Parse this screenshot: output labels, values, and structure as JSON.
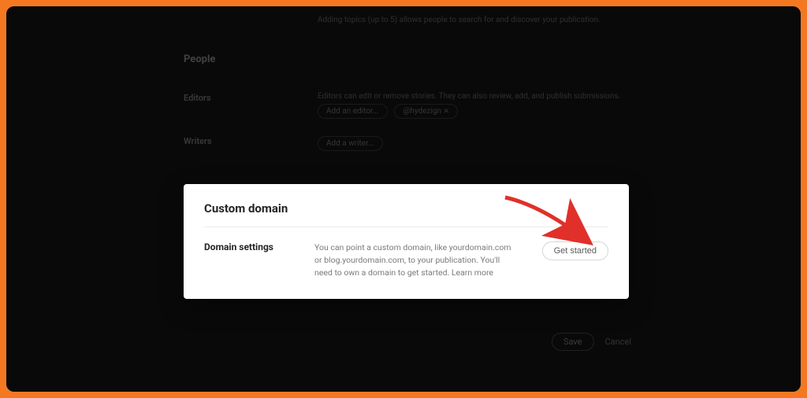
{
  "bg": {
    "top_note": "Adding topics (up to 5) allows people to search for and discover your publication.",
    "people_heading": "People",
    "editors_label": "Editors",
    "editors_desc": "Editors can edit or remove stories. They can also review, add, and publish submissions.",
    "add_editor": "Add an editor...",
    "editor_chip": "@hydezign",
    "writers_label": "Writers",
    "add_writer": "Add a writer...",
    "save": "Save",
    "cancel": "Cancel"
  },
  "modal": {
    "title": "Custom domain",
    "row_label": "Domain settings",
    "description": "You can point a custom domain, like yourdomain.com or blog.yourdomain.com, to your publication. You'll need to own a domain to get started. Learn more",
    "button": "Get started"
  }
}
